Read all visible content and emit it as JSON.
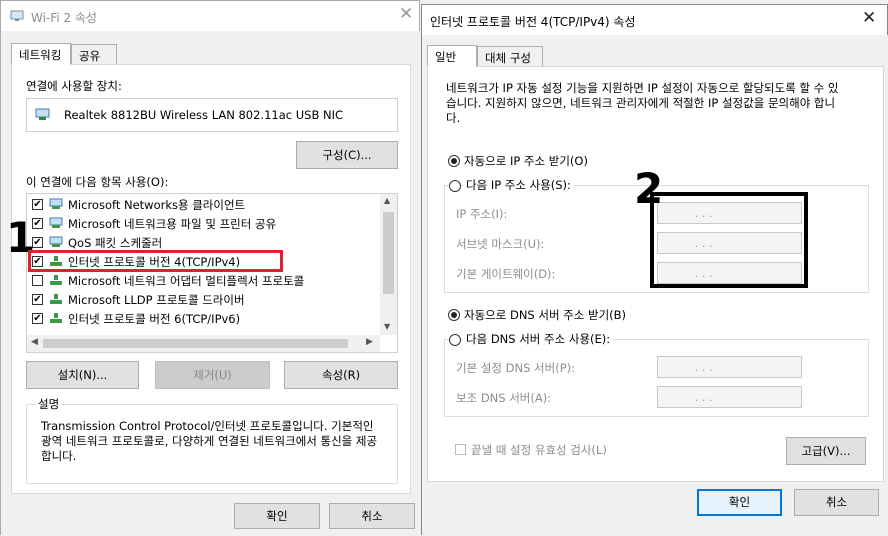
{
  "left_window": {
    "title": "Wi-Fi 2 속성",
    "tabs": [
      "네트워킹",
      "공유"
    ],
    "connect_using_label": "연결에 사용할 장치:",
    "adapter_name": "Realtek 8812BU Wireless LAN 802.11ac USB NIC",
    "configure_button": "구성(C)...",
    "items_label": "이 연결에 다음 항목 사용(O):",
    "items": [
      {
        "label": "Microsoft Networks용 클라이언트",
        "checked": true
      },
      {
        "label": "Microsoft 네트워크용 파일 및 프린터 공유",
        "checked": true
      },
      {
        "label": "QoS 패킷 스케줄러",
        "checked": true
      },
      {
        "label": "인터넷 프로토콜 버전 4(TCP/IPv4)",
        "checked": true
      },
      {
        "label": "Microsoft 네트워크 어댑터 멀티플렉서 프로토콜",
        "checked": false
      },
      {
        "label": "Microsoft LLDP 프로토콜 드라이버",
        "checked": true
      },
      {
        "label": "인터넷 프로토콜 버전 6(TCP/IPv6)",
        "checked": true
      }
    ],
    "install_button": "설치(N)...",
    "uninstall_button": "제거(U)",
    "properties_button": "속성(R)",
    "description_label": "설명",
    "description_text": "Transmission Control Protocol/인터넷 프로토콜입니다. 기본적인 광역 네트워크 프로토콜로, 다양하게 연결된 네트워크에서 통신을 제공합니다.",
    "ok_button": "확인",
    "cancel_button": "취소"
  },
  "right_window": {
    "title": "인터넷 프로토콜 버전 4(TCP/IPv4) 속성",
    "tabs": [
      "일반",
      "대체 구성"
    ],
    "intro_text": "네트워크가 IP 자동 설정 기능을 지원하면 IP 설정이 자동으로 할당되도록 할 수 있습니다. 지원하지 않으면, 네트워크 관리자에게 적절한 IP 설정값을 문의해야 합니다.",
    "auto_ip_label": "자동으로 IP 주소 받기(O)",
    "manual_ip_label": "다음 IP 주소 사용(S):",
    "ip_address_label": "IP 주소(I):",
    "subnet_label": "서브넷 마스크(U):",
    "gateway_label": "기본 게이트웨이(D):",
    "auto_dns_label": "자동으로 DNS 서버 주소 받기(B)",
    "manual_dns_label": "다음 DNS 서버 주소 사용(E):",
    "preferred_dns_label": "기본 설정 DNS 서버(P):",
    "alternate_dns_label": "보조 DNS 서버(A):",
    "validate_label": "끝낼 때 설정 유효성 검사(L)",
    "advanced_button": "고급(V)...",
    "ok_button": "확인",
    "cancel_button": "취소",
    "ip_placeholder_dots": ".          .          ."
  },
  "annotations": {
    "step1": "1",
    "step2": "2",
    "highlight_color": "#e0202a",
    "box_color": "#000000"
  }
}
